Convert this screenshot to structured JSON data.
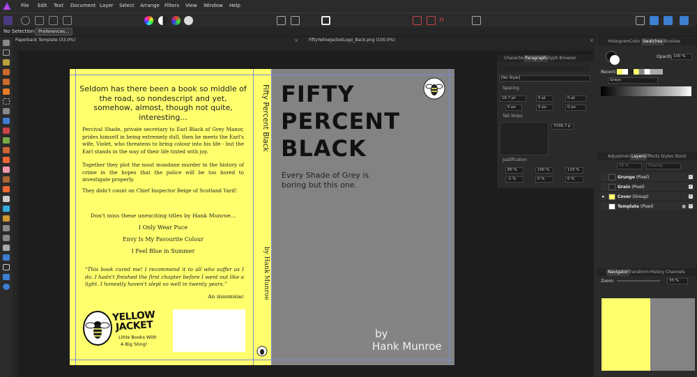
{
  "menubar": {
    "items": [
      "File",
      "Edit",
      "Text",
      "Document",
      "Layer",
      "Select",
      "Arrange",
      "Filters",
      "View",
      "Window",
      "Help"
    ]
  },
  "context": {
    "selection": "No Selection",
    "preferences": "Preferences..."
  },
  "tabs": {
    "doc1": "Paperback Template (33.0%)",
    "doc2": "FiftyYellowJacketLogo_Back.png (100.0%)"
  },
  "cover": {
    "back": {
      "tagline": "Seldom has there been a book so middle of the road, so nondescript and yet, somehow, almost, though not quite, interesting...",
      "para1": "Percival Shade, private secretary to Earl Black of Grey Manor, prides himself in being extremely dull, then he meets the Earl's wife, Violet, who threatens to bring colour into his life - but the Earl stands in the way of their life tinted with joy.",
      "para2": "Together they plot the most mundane murder in the history of crime in the hopes that the police will be too bored to investigate properly.",
      "para3": "They didn't count on Chief Inspector Beige of Scotland Yard!",
      "other_titles_heading": "Don't miss these unexciting titles by Hank Munroe...",
      "titles": [
        "I Only Wear Puce",
        "Envy Is My Favourite Colour",
        "I Feel Blue in Summer"
      ],
      "quote": "\"This book cured me! I recommend it to all who suffer as I do. I hadn't finished the first chapter before I went out like a light. I honestly haven't slept so well in twenty years.\"",
      "quote_attrib": "An insomniac",
      "logo_line1": "YELLOW",
      "logo_line2": "JACKET",
      "logo_sub1": "Little Books With",
      "logo_sub2": "A Big Sting!"
    },
    "spine": {
      "title": "Fifty Percent Black",
      "author": "by Hank Munroe"
    },
    "front": {
      "title1": "FIFTY",
      "title2": "PERCENT",
      "title3": "BLACK",
      "subtitle1": "Every Shade of Grey is",
      "subtitle2": "boring but this one.",
      "by": "by",
      "author": "Hank Munroe"
    }
  },
  "char_panel": {
    "tabs": [
      "Character",
      "Paragraph",
      "Glyph Browser"
    ],
    "style": "[No Style]",
    "spacing_label": "Spacing",
    "spacing_values": [
      "16.7 pt",
      "0 pt",
      "0 pt",
      "0 px",
      "0 px",
      "0 px"
    ],
    "tabstops_label": "Tab Stops",
    "tabstop_value": "7036.7 p",
    "justification_label": "Justification",
    "just_values": [
      "80 %",
      "100 %",
      "133 %",
      "-1 %",
      "0 %",
      "0 %"
    ]
  },
  "right_panel": {
    "top_tabs": [
      "Histogram",
      "Color",
      "Swatches",
      "Brushes"
    ],
    "opacity_label": "Opacity:",
    "opacity_value": "100 %",
    "recent_label": "Recent:",
    "palette": "Grays",
    "layers_tabs": [
      "Adjustment",
      "Layers",
      "Effects",
      "Styles",
      "Stock"
    ],
    "layer_opacity": "20 %",
    "blend_mode": "Overlay",
    "layers": [
      {
        "name": "Grunge",
        "type": "(Pixel)"
      },
      {
        "name": "Grain",
        "type": "(Pixel)"
      },
      {
        "name": "Cover",
        "type": "(Group)"
      },
      {
        "name": "Template",
        "type": "(Pixel)"
      }
    ],
    "nav_tabs": [
      "Navigator",
      "Transform",
      "History",
      "Channels"
    ],
    "zoom_label": "Zoom:",
    "zoom_value": "33 %"
  },
  "colors": {
    "cover_yellow": "#ffff6e",
    "cover_grey": "#838383",
    "ui_dark": "#2b2b2b"
  }
}
